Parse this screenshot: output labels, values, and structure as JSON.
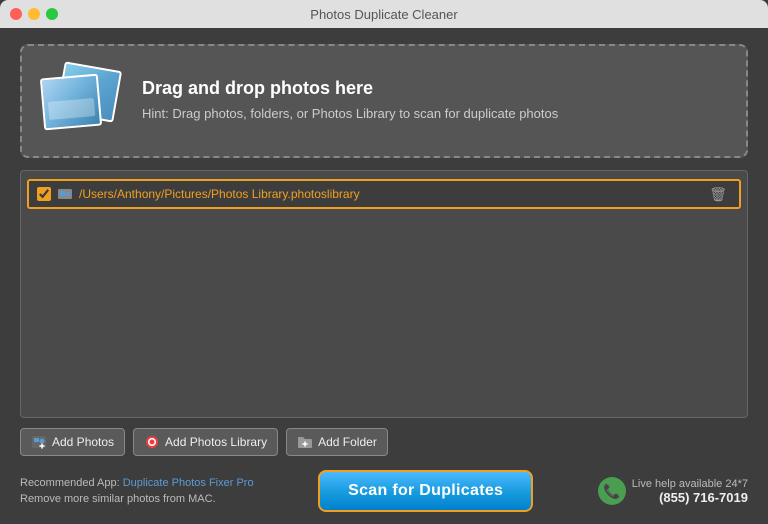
{
  "window": {
    "title": "Photos Duplicate Cleaner"
  },
  "titlebar": {
    "buttons": {
      "close": "close",
      "minimize": "minimize",
      "maximize": "maximize"
    }
  },
  "dropzone": {
    "heading": "Drag and drop photos here",
    "hint": "Hint: Drag photos, folders, or Photos Library to scan for duplicate photos"
  },
  "file_list": [
    {
      "checked": true,
      "path": "/Users/Anthony/Pictures/Photos Library.photoslibrary",
      "delete_label": "🗑"
    }
  ],
  "toolbar": {
    "add_photos_label": "Add Photos",
    "add_library_label": "Add Photos Library",
    "add_folder_label": "Add Folder"
  },
  "footer": {
    "recommended_label": "Recommended App:",
    "app_link_label": "Duplicate Photos Fixer Pro",
    "remove_label": "Remove more similar photos from MAC.",
    "scan_button_label": "Scan for Duplicates",
    "help_label": "Live help available 24*7",
    "phone": "(855) 716-7019"
  }
}
